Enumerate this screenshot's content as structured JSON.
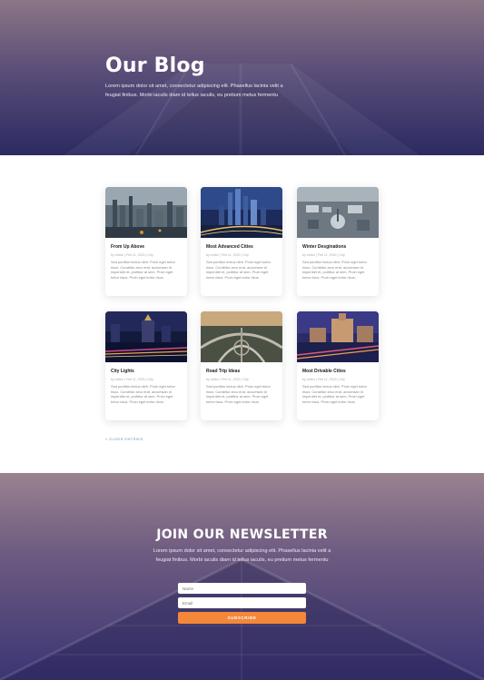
{
  "hero": {
    "title": "Our Blog",
    "text": "Lorem ipsum dolor sit amet, consectetur adipiscing elit. Phasellus lacinia velit a feugiat finibus. Morbi iaculis diam id tellus iaculis, eu pretium metus fermentu"
  },
  "posts": [
    {
      "title": "From Up Above",
      "meta": "by editor | Feb 11, 2020 | City",
      "excerpt": "Sed porttitor lectus nibh. Proin eget tortor risus. Curabitur arcu erat, accumsan id imperdiet et, porttitor at sem. Proin eget tortor risus. Proin eget tortor risus.",
      "image": "city-skyline-aerial"
    },
    {
      "title": "Most Advanced Cities",
      "meta": "by editor | Feb 11, 2020 | City",
      "excerpt": "Sed porttitor lectus nibh. Proin eget tortor risus. Curabitur arcu erat, accumsan id imperdiet et, porttitor at sem. Proin eget tortor risus. Proin eget tortor risus.",
      "image": "night-skyscrapers"
    },
    {
      "title": "Winter Desginations",
      "meta": "by editor | Feb 11, 2020 | City",
      "excerpt": "Sed porttitor lectus nibh. Proin eget tortor risus. Curabitur arcu erat, accumsan id imperdiet et, porttitor at sem. Proin eget tortor risus. Proin eget tortor risus.",
      "image": "winter-city-aerial"
    },
    {
      "title": "City Lights",
      "meta": "by editor | Feb 11, 2020 | City",
      "excerpt": "Sed porttitor lectus nibh. Proin eget tortor risus. Curabitur arcu erat, accumsan id imperdiet et, porttitor at sem. Proin eget tortor risus. Proin eget tortor risus.",
      "image": "city-lights-street"
    },
    {
      "title": "Road Trip Ideas",
      "meta": "by editor | Feb 11, 2020 | City",
      "excerpt": "Sed porttitor lectus nibh. Proin eget tortor risus. Curabitur arcu erat, accumsan id imperdiet et, porttitor at sem. Proin eget tortor risus. Proin eget tortor risus.",
      "image": "highway-interchange"
    },
    {
      "title": "Most Drivable Cities",
      "meta": "by editor | Feb 11, 2020 | City",
      "excerpt": "Sed porttitor lectus nibh. Proin eget tortor risus. Curabitur arcu erat, accumsan id imperdiet et, porttitor at sem. Proin eget tortor risus. Proin eget tortor risus.",
      "image": "dusk-boulevard-light-trails"
    }
  ],
  "load_more": "« Older Entries",
  "newsletter": {
    "title": "JOIN OUR NEWSLETTER",
    "text": "Lorem ipsum dolor sit amet, consectetur adipiscing elit. Phasellus lacinia velit a feugiat finibus. Morbi iaculis diam id tellus iaculis, eu pretium metus fermentu",
    "name_placeholder": "Name",
    "email_placeholder": "Email",
    "button_label": "SUBSCRIBE"
  },
  "colors": {
    "accent": "#f4873a",
    "link": "#6b8fd6",
    "hero_top": "#8b7686",
    "hero_bottom": "#2c2a62"
  }
}
